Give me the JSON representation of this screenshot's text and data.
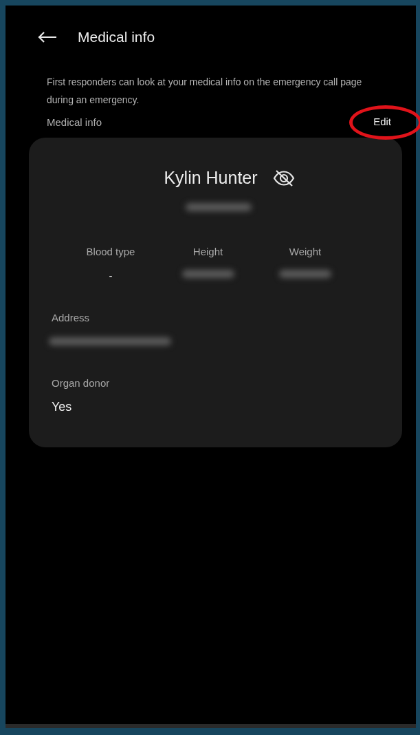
{
  "header": {
    "title": "Medical info"
  },
  "description": "First responders can look at your medical info on the emergency call page during an emergency.",
  "section": {
    "label": "Medical info",
    "action": "Edit",
    "action_circled": true
  },
  "card": {
    "name": "Kylin Hunter",
    "subtitle": {
      "kind": "blurred"
    },
    "stats": [
      {
        "label": "Blood type",
        "kind": "text",
        "value": "-"
      },
      {
        "label": "Height",
        "kind": "blurred"
      },
      {
        "label": "Weight",
        "kind": "blurred"
      }
    ],
    "fields": [
      {
        "label": "Address",
        "kind": "blurred"
      },
      {
        "label": "Organ donor",
        "kind": "text",
        "value": "Yes"
      }
    ]
  }
}
